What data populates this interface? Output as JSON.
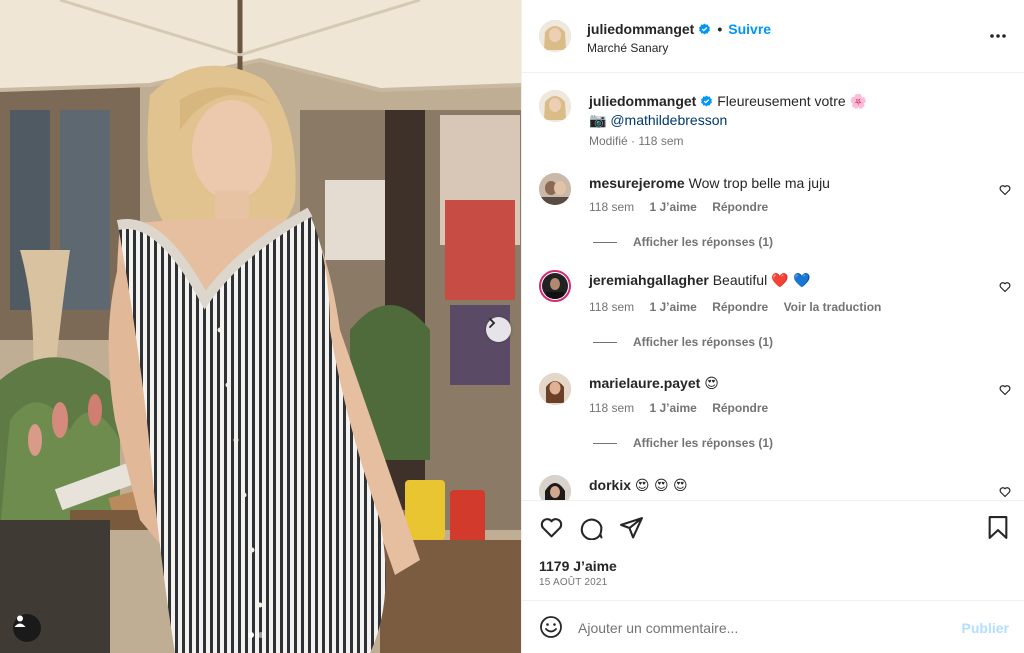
{
  "post": {
    "username": "juliedommanget",
    "follow_label": "Suivre",
    "separator": "•",
    "location": "Marché Sanary",
    "more_label": "Plus d'options"
  },
  "caption": {
    "username": "juliedommanget",
    "text": "Fleureusement votre",
    "flower_emoji": "🌸",
    "camera_emoji": "📷",
    "mention": "@mathildebresson",
    "meta": "Modifié · 118 sem"
  },
  "comments": [
    {
      "username": "mesurejerome",
      "text": "Wow trop belle ma juju",
      "emojis": "",
      "time": "118 sem",
      "likes": "1 J’aime",
      "reply": "Répondre",
      "translate": "",
      "replies": "Afficher les réponses (1)"
    },
    {
      "username": "jeremiahgallagher",
      "text": "Beautiful",
      "emojis": "❤️ 💙",
      "time": "118 sem",
      "likes": "1 J’aime",
      "reply": "Répondre",
      "translate": "Voir la traduction",
      "replies": "Afficher les réponses (1)"
    },
    {
      "username": "marielaure.payet",
      "text": "",
      "emojis": "😍",
      "time": "118 sem",
      "likes": "1 J’aime",
      "reply": "Répondre",
      "translate": "",
      "replies": "Afficher les réponses (1)"
    },
    {
      "username": "dorkix",
      "text": "",
      "emojis": "😍 😍 😍",
      "time": "",
      "likes": "",
      "reply": "",
      "translate": "",
      "replies": ""
    }
  ],
  "stats": {
    "likes": "1179 J’aime",
    "date": "15 AOÛT 2021"
  },
  "composer": {
    "placeholder": "Ajouter un commentaire...",
    "publish_label": "Publier"
  },
  "colors": {
    "accent": "#0095f6",
    "verified": "#0095f6",
    "muted_text": "#737373",
    "publish_disabled": "#b2dffc"
  },
  "icons": [
    "chevron-right-icon",
    "user-tag-icon",
    "more-icon",
    "heart-icon",
    "comment-icon",
    "share-icon",
    "bookmark-icon",
    "emoji-icon",
    "verified-icon"
  ]
}
